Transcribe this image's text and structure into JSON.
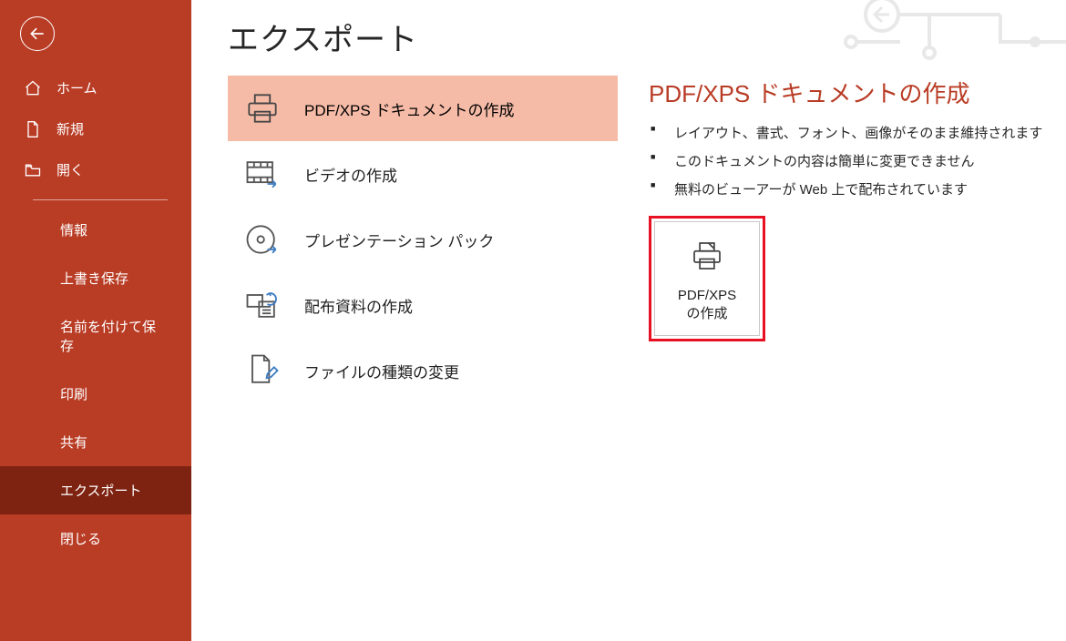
{
  "page": {
    "title": "エクスポート"
  },
  "sidebar": {
    "primary": [
      {
        "label": "ホーム"
      },
      {
        "label": "新規"
      },
      {
        "label": "開く"
      }
    ],
    "secondary": [
      {
        "label": "情報"
      },
      {
        "label": "上書き保存"
      },
      {
        "label": "名前を付けて保存"
      },
      {
        "label": "印刷"
      },
      {
        "label": "共有"
      },
      {
        "label": "エクスポート"
      },
      {
        "label": "閉じる"
      }
    ]
  },
  "options": [
    {
      "label": "PDF/XPS ドキュメントの作成"
    },
    {
      "label": "ビデオの作成"
    },
    {
      "label": "プレゼンテーション パック"
    },
    {
      "label": "配布資料の作成"
    },
    {
      "label": "ファイルの種類の変更"
    }
  ],
  "detail": {
    "title": "PDF/XPS ドキュメントの作成",
    "bullets": [
      "レイアウト、書式、フォント、画像がそのまま維持されます",
      "このドキュメントの内容は簡単に変更できません",
      "無料のビューアーが Web 上で配布されています"
    ],
    "button": {
      "line1": "PDF/XPS",
      "line2": "の作成"
    }
  }
}
